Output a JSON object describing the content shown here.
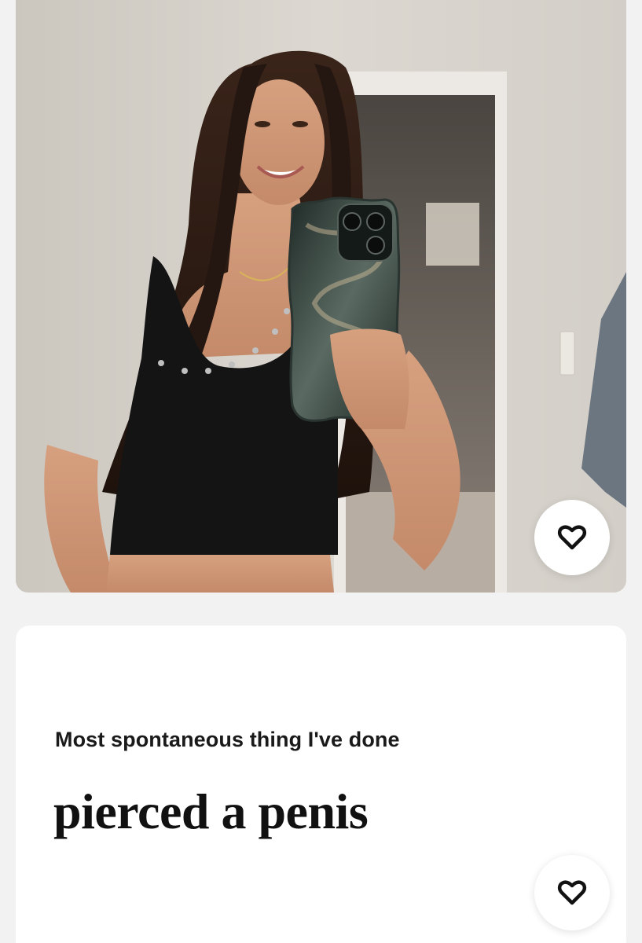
{
  "profile_photo": {
    "alt": "profile-photo",
    "colors": {
      "wall": "#d8d4cc",
      "door_frame": "#e9e7e2",
      "hair": "#2a1a14",
      "top": "#151515",
      "skin": "#c98f6f",
      "phone_case": "#2f3a36"
    }
  },
  "photo_like": {
    "icon": "heart-like-icon"
  },
  "prompt": {
    "question": "Most spontaneous thing I've done",
    "answer": "pierced a penis"
  },
  "prompt_like": {
    "icon": "heart-like-icon"
  },
  "colors": {
    "background": "#f2f2f2",
    "card": "#ffffff",
    "text": "#111111"
  }
}
